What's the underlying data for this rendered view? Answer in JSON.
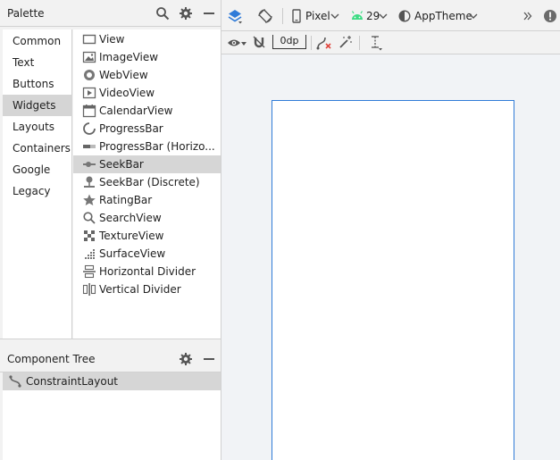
{
  "palette": {
    "title": "Palette",
    "categories": [
      "Common",
      "Text",
      "Buttons",
      "Widgets",
      "Layouts",
      "Containers",
      "Google",
      "Legacy"
    ],
    "selected_category": "Widgets",
    "widgets": [
      {
        "label": "View",
        "icon": "view-icon"
      },
      {
        "label": "ImageView",
        "icon": "imageview-icon"
      },
      {
        "label": "WebView",
        "icon": "webview-icon"
      },
      {
        "label": "VideoView",
        "icon": "videoview-icon"
      },
      {
        "label": "CalendarView",
        "icon": "calendarview-icon"
      },
      {
        "label": "ProgressBar",
        "icon": "progressbar-icon"
      },
      {
        "label": "ProgressBar (Horizo...",
        "icon": "progressbar-horizontal-icon"
      },
      {
        "label": "SeekBar",
        "icon": "seekbar-icon"
      },
      {
        "label": "SeekBar (Discrete)",
        "icon": "seekbar-discrete-icon"
      },
      {
        "label": "RatingBar",
        "icon": "ratingbar-icon"
      },
      {
        "label": "SearchView",
        "icon": "searchview-icon"
      },
      {
        "label": "TextureView",
        "icon": "textureview-icon"
      },
      {
        "label": "SurfaceView",
        "icon": "surfaceview-icon"
      },
      {
        "label": "Horizontal Divider",
        "icon": "horizontal-divider-icon"
      },
      {
        "label": "Vertical Divider",
        "icon": "vertical-divider-icon"
      }
    ],
    "selected_widget": "SeekBar"
  },
  "component_tree": {
    "title": "Component Tree",
    "root": {
      "label": "ConstraintLayout",
      "icon": "constraintlayout-icon"
    }
  },
  "toolbar": {
    "device": "Pixel",
    "api_level": "29",
    "theme": "AppTheme",
    "default_margin": "0dp"
  },
  "colors": {
    "selection": "#d6d6d6",
    "device_border": "#2f7bd8",
    "android_green": "#3ddc84",
    "layers_blue": "#2f7bd8",
    "error_red": "#e0473e"
  }
}
